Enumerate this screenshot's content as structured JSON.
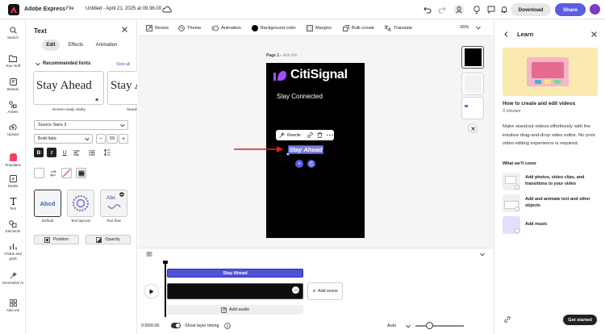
{
  "header": {
    "app_name": "Adobe Express",
    "file_menu": "File",
    "doc_title": "Untitled - April 21, 2025 at 09.36.00",
    "download_label": "Download",
    "share_label": "Share",
    "brand_color": "#5c5ce0"
  },
  "rail": {
    "items": [
      {
        "label": "Search",
        "icon": "search-icon"
      },
      {
        "label": "Your stuff",
        "icon": "folder-icon"
      },
      {
        "label": "Brands",
        "icon": "brands-icon"
      },
      {
        "label": "Assets",
        "icon": "assets-icon"
      },
      {
        "label": "Upload",
        "icon": "upload-icon"
      },
      {
        "label": "Templates",
        "icon": "templates-icon"
      },
      {
        "label": "Media",
        "icon": "media-icon"
      },
      {
        "label": "Text",
        "icon": "text-icon"
      },
      {
        "label": "Elements",
        "icon": "elements-icon"
      },
      {
        "label": "Charts and grids",
        "icon": "charts-icon"
      },
      {
        "label": "Generative AI",
        "icon": "generative-ai-icon"
      },
      {
        "label": "Add-ons",
        "icon": "addons-icon"
      }
    ]
  },
  "text_panel": {
    "title": "Text",
    "tabs": [
      "Edit",
      "Effects",
      "Animation"
    ],
    "recommended_label": "Recommended fonts",
    "view_all": "View all",
    "font_cards": [
      {
        "sample": "Stay Ahead",
        "caption": "Screen-ready clarity"
      },
      {
        "sample": "Stay A",
        "caption": "Stand-"
      }
    ],
    "font_family": "Source Sans 3",
    "font_style": "Bold Italic",
    "font_size": "59",
    "minus": "−",
    "plus": "+",
    "text_styles": [
      {
        "label": "Default",
        "sample": "Abcd"
      },
      {
        "label": "Text layouts"
      },
      {
        "label": "Text flow",
        "sample": "Abc"
      }
    ],
    "position_label": "Position",
    "opacity_label": "Opacity"
  },
  "canvas_toolbar": {
    "items": [
      "Resize",
      "Theme",
      "Animation",
      "Background color",
      "Margins",
      "Bulk create",
      "Translate"
    ],
    "zoom": "26%"
  },
  "canvas": {
    "page_label": "Page 1 - ",
    "add_title": "Add title",
    "brand_text": "CitiSignal",
    "subtitle": "Stay Connected",
    "selected_text": "Stay Ahead",
    "float_rewrite": "Rewrite"
  },
  "timeline": {
    "text_track": "Stay Ahead",
    "add_scene": "Add scene",
    "add_audio": "Add audio",
    "time": "0:00/0:05",
    "show_layer_timing": "Show layer timing",
    "auto": "Auto"
  },
  "learn": {
    "title": "Learn",
    "heading": "How to create and edit videos",
    "duration": "3 minutes",
    "description": "Make standout videos effortlessly with the intuitive drag-and-drop video editor. No prior video editing experience is required.",
    "cover_label": "What we'll cover",
    "items": [
      "Add photos, video clips, and transitions to your video",
      "Add and animate text and other objects",
      "Add music"
    ],
    "get_started": "Get started"
  }
}
